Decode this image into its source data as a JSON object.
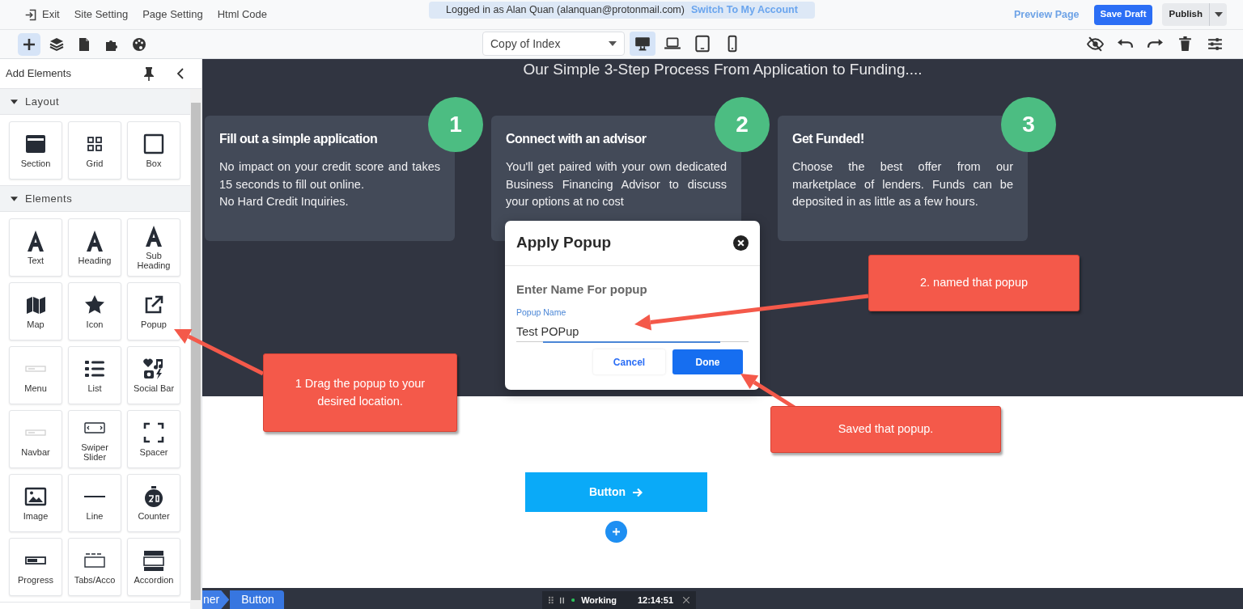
{
  "top_menu": [
    {
      "label": "Exit",
      "kind": "exit"
    },
    {
      "label": "Site Setting",
      "kind": "plain"
    },
    {
      "label": "Page Setting",
      "kind": "plain"
    },
    {
      "label": "Html Code",
      "kind": "plain"
    }
  ],
  "login_banner": {
    "text": "Logged in as Alan Quan (alanquan@protonmail.com)",
    "link": "Switch To My Account"
  },
  "actions": {
    "preview": "Preview Page",
    "save": "Save Draft",
    "publish": "Publish"
  },
  "tools": [
    {
      "selected": true
    },
    {
      "selected": false
    },
    {
      "selected": false
    },
    {
      "selected": false
    },
    {
      "selected": false
    }
  ],
  "page_select": {
    "value": "Copy of Index"
  },
  "devices": [
    {
      "selected": true
    },
    {
      "selected": false
    },
    {
      "selected": false
    },
    {
      "selected": false
    }
  ],
  "sidebar": {
    "title": "Add Elements",
    "groups": [
      {
        "label": "Layout",
        "expanded": true,
        "items": [
          {
            "label": "Section"
          },
          {
            "label": "Grid"
          },
          {
            "label": "Box"
          }
        ]
      },
      {
        "label": "Elements",
        "expanded": true,
        "items": [
          {
            "label": "Text"
          },
          {
            "label": "Heading"
          },
          {
            "label": "Sub Heading"
          },
          {
            "label": "Map"
          },
          {
            "label": "Icon"
          },
          {
            "label": "Popup"
          },
          {
            "label": "Menu"
          },
          {
            "label": "List"
          },
          {
            "label": "Social Bar"
          },
          {
            "label": "Navbar"
          },
          {
            "label": "Swiper Slider"
          },
          {
            "label": "Spacer"
          },
          {
            "label": "Image"
          },
          {
            "label": "Line"
          },
          {
            "label": "Counter"
          },
          {
            "label": "Progress"
          },
          {
            "label": "Tabs/Acco"
          },
          {
            "label": "Accordion"
          }
        ]
      }
    ]
  },
  "section": {
    "heading": "Our Simple 3-Step Process From Application to Funding....",
    "steps": [
      {
        "number": "1",
        "title": "Fill out a simple application",
        "body": "No impact on your credit score and takes 15 seconds to fill out online.\nNo Hard Credit Inquiries."
      },
      {
        "number": "2",
        "title": "Connect with an advisor",
        "body": "You'll get paired with your own dedicated Business Financing Advisor to discuss your options at no cost"
      },
      {
        "number": "3",
        "title": "Get Funded!",
        "body": "Choose the best offer from our marketplace of lenders. Funds can be deposited in as little as a few hours."
      }
    ]
  },
  "popup": {
    "title": "Apply Popup",
    "prompt": "Enter Name For popup",
    "field_label": "Popup Name",
    "value": "Test POPup",
    "cancel": "Cancel",
    "done": "Done"
  },
  "page_button": {
    "label": "Button"
  },
  "breadcrumb": [
    {
      "label": "ner"
    },
    {
      "label": "Button"
    }
  ],
  "status": {
    "state": "Working",
    "time": "12:14:51"
  },
  "annotations": [
    {
      "text": "1 Drag the popup to your desired location."
    },
    {
      "text": "2. named that popup"
    },
    {
      "text": "Saved that popup."
    }
  ]
}
